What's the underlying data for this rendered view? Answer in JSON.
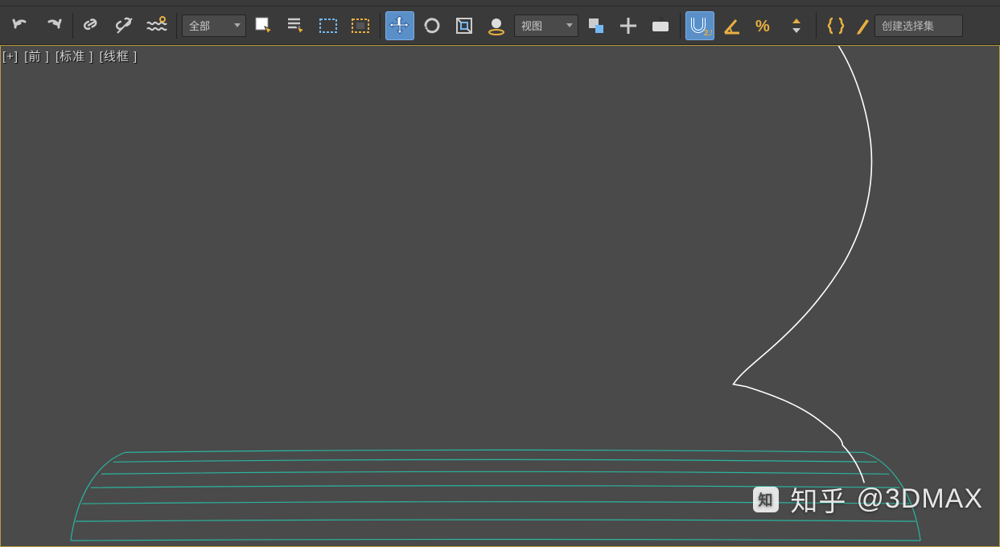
{
  "toolbar": {
    "filter_dropdown": "全部",
    "view_dropdown": "视图",
    "selection_set_placeholder": "创建选择集",
    "snap_label": "2.5"
  },
  "viewport": {
    "menu": "[+]",
    "name": "[前 ]",
    "shading": "[标准 ]",
    "style": "[线框 ]",
    "active_border_color": "#b89940",
    "wireframe_color": "#2bb5a0",
    "spline_color": "#ffffff"
  },
  "watermark": {
    "site": "知乎",
    "handle": "@3DMAX"
  }
}
